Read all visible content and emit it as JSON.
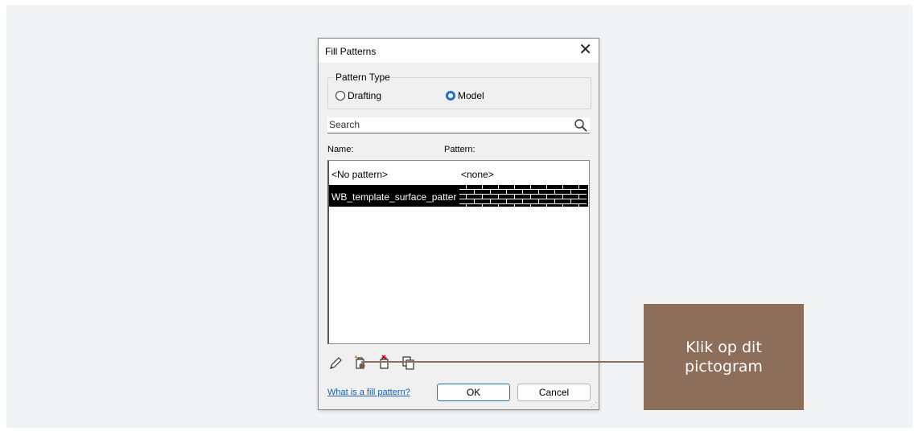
{
  "dialog": {
    "title": "Fill Patterns",
    "close_glyph": "✕",
    "pattern_type": {
      "label": "Pattern Type",
      "options": [
        {
          "label": "Drafting",
          "selected": false
        },
        {
          "label": "Model",
          "selected": true
        }
      ]
    },
    "search": {
      "placeholder": "Search",
      "value": "",
      "icon": "search-icon"
    },
    "columns": {
      "name": "Name:",
      "pattern": "Pattern:"
    },
    "rows": [
      {
        "name": "<No pattern>",
        "pattern": "<none>",
        "selected": false
      },
      {
        "name": "WB_template_surface_patter",
        "pattern": "brick-pattern-preview",
        "selected": true
      }
    ],
    "tools": [
      "edit-pencil-icon",
      "new-pattern-icon",
      "delete-pattern-icon",
      "duplicate-pattern-icon"
    ],
    "help_link": "What is a fill pattern?",
    "ok_label": "OK",
    "cancel_label": "Cancel"
  },
  "callout": {
    "text": "Klik op dit pictogram",
    "color": "#8c6e5b"
  },
  "colors": {
    "accent": "#1f6fd4",
    "selection": "#000000",
    "link": "#1a5fb4"
  }
}
